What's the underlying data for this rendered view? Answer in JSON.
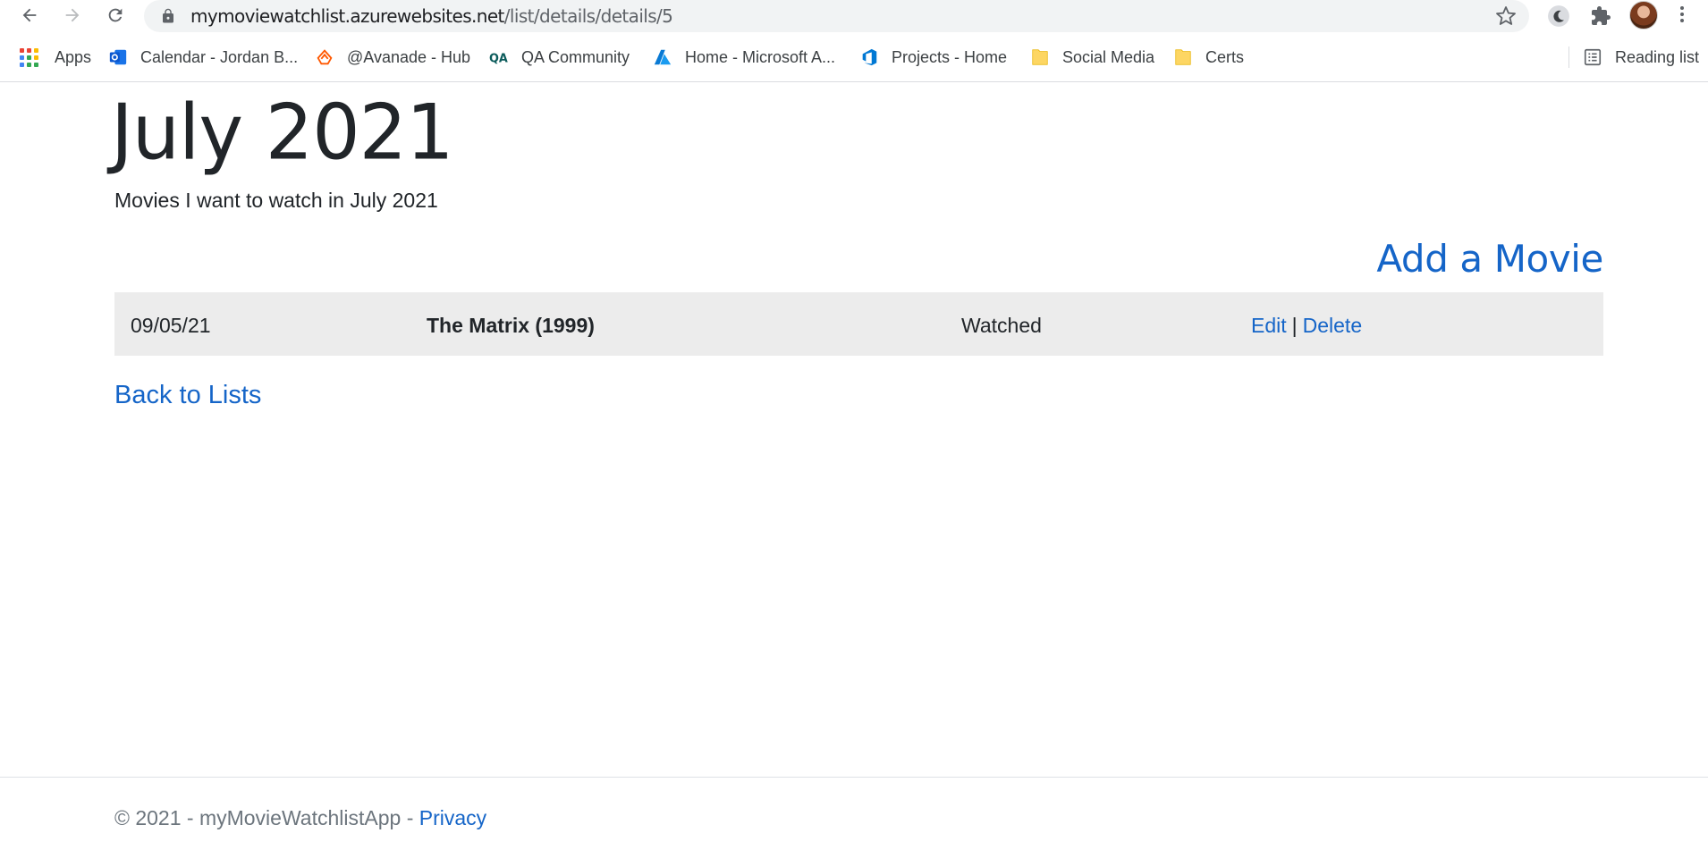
{
  "browser": {
    "url_host": "mymoviewatchlist.azurewebsites.net",
    "url_path": "/list/details/details/5",
    "bookmarks": [
      {
        "label": "Apps",
        "icon": "apps-grid-icon"
      },
      {
        "label": "Calendar - Jordan B...",
        "icon": "outlook-icon"
      },
      {
        "label": "@Avanade - Hub",
        "icon": "avanade-icon"
      },
      {
        "label": "QA Community",
        "icon": "qa-icon"
      },
      {
        "label": "Home - Microsoft A...",
        "icon": "azure-icon"
      },
      {
        "label": "Projects - Home",
        "icon": "devops-icon"
      },
      {
        "label": "Social Media",
        "icon": "folder-icon"
      },
      {
        "label": "Certs",
        "icon": "folder-icon"
      }
    ],
    "reading_list": "Reading list"
  },
  "page": {
    "title": "July 2021",
    "subtitle": "Movies I want to watch in July 2021",
    "add_link": "Add a Movie",
    "movies": [
      {
        "date": "09/05/21",
        "title": "The Matrix (1999)",
        "status": "Watched",
        "edit": "Edit",
        "separator": "|",
        "delete": "Delete"
      }
    ],
    "back_link": "Back to Lists"
  },
  "footer": {
    "text": "© 2021 - myMovieWatchlistApp - ",
    "privacy": "Privacy"
  },
  "colors": {
    "link": "#1565c8",
    "row_background": "#ececec",
    "chrome_background": "#f1f3f4"
  }
}
